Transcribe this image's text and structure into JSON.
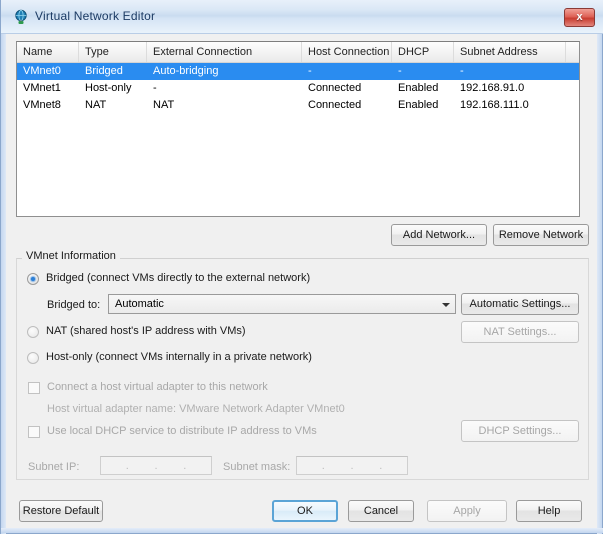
{
  "window": {
    "title": "Virtual Network Editor",
    "icon": "network-globe-icon",
    "close_label": "x",
    "accent_selection": "#2a8cf0",
    "titlebar_text_color": "#1b3a63"
  },
  "network_list": {
    "columns": [
      {
        "key": "name",
        "label": "Name"
      },
      {
        "key": "type",
        "label": "Type"
      },
      {
        "key": "ext",
        "label": "External Connection"
      },
      {
        "key": "host",
        "label": "Host Connection"
      },
      {
        "key": "dhcp",
        "label": "DHCP"
      },
      {
        "key": "sub",
        "label": "Subnet Address"
      }
    ],
    "rows": [
      {
        "name": "VMnet0",
        "type": "Bridged",
        "ext": "Auto-bridging",
        "host": "-",
        "dhcp": "-",
        "sub": "-",
        "selected": true
      },
      {
        "name": "VMnet1",
        "type": "Host-only",
        "ext": "-",
        "host": "Connected",
        "dhcp": "Enabled",
        "sub": "192.168.91.0",
        "selected": false
      },
      {
        "name": "VMnet8",
        "type": "NAT",
        "ext": "NAT",
        "host": "Connected",
        "dhcp": "Enabled",
        "sub": "192.168.111.0",
        "selected": false
      }
    ],
    "add_network_label": "Add Network...",
    "remove_network_label": "Remove Network"
  },
  "vmnet_info": {
    "legend": "VMnet Information",
    "options": [
      {
        "label": "Bridged (connect VMs directly to the external network)",
        "selected": true,
        "enabled": true
      },
      {
        "label": "NAT (shared host's IP address with VMs)",
        "selected": false,
        "enabled": false
      },
      {
        "label": "Host-only (connect VMs internally in a private network)",
        "selected": false,
        "enabled": false
      }
    ],
    "bridged_to": {
      "label": "Bridged to:",
      "value": "Automatic",
      "options": [
        "Automatic"
      ]
    },
    "automatic_settings_label": "Automatic Settings...",
    "nat_settings_label": "NAT Settings...",
    "dhcp_settings_label": "DHCP Settings...",
    "connect_host_adapter": {
      "label": "Connect a host virtual adapter to this network",
      "checked": false,
      "enabled": false
    },
    "host_adapter_name": "Host virtual adapter name: VMware Network Adapter VMnet0",
    "local_dhcp": {
      "label": "Use local DHCP service to distribute IP address to VMs",
      "checked": false,
      "enabled": false
    },
    "subnet_ip": {
      "label": "Subnet IP:",
      "octets": [
        "",
        "",
        "",
        ""
      ]
    },
    "subnet_mask": {
      "label": "Subnet mask:",
      "octets": [
        "",
        "",
        "",
        ""
      ]
    }
  },
  "footer": {
    "restore_default_label": "Restore Default",
    "ok_label": "OK",
    "cancel_label": "Cancel",
    "apply_label": "Apply",
    "help_label": "Help"
  }
}
